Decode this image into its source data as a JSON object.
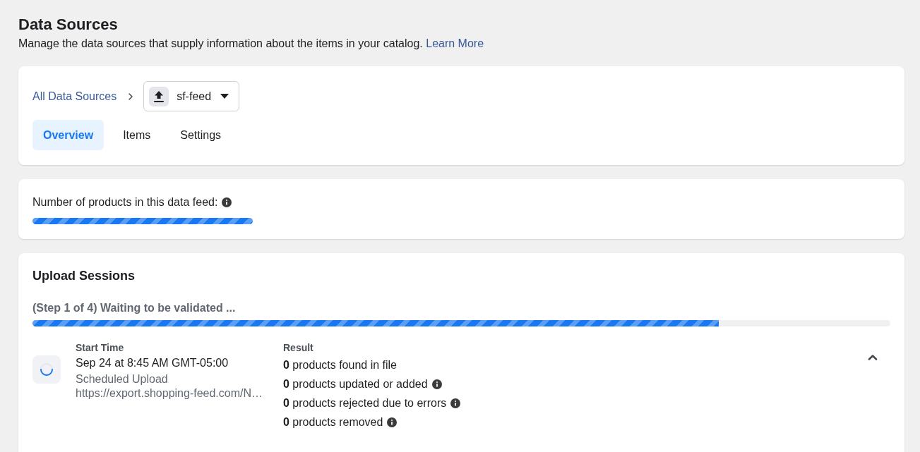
{
  "header": {
    "title": "Data Sources",
    "description": "Manage the data sources that supply information about the items in your catalog.",
    "link": "Learn More"
  },
  "source_card": {
    "breadcrumb": {
      "link": "All Data Sources"
    },
    "source_selector": {
      "value": "sf-feed"
    },
    "tabs": [
      {
        "label": "Overview",
        "selected": true
      },
      {
        "label": "Items",
        "selected": false
      },
      {
        "label": "Settings",
        "selected": false
      }
    ]
  },
  "product_count": {
    "label": "Number of products in this data feed:"
  },
  "upload_sessions": {
    "title": "Upload Sessions",
    "status": "(Step 1 of 4) Waiting to be validated ...",
    "level": 0.8,
    "sessions": [
      {
        "expanded": true,
        "start_time_label": "Start Time",
        "start_time": "Sep 24 at 8:45 AM GMT-05:00",
        "upload_type": "Scheduled Upload",
        "url": "https://export.shopping-feed.com/N…",
        "result_label": "Result",
        "results": [
          {
            "text": "**0** products found in file",
            "info": false
          },
          {
            "text": "**0** products updated or added",
            "info": true
          },
          {
            "text": "**0** products rejected due to errors",
            "info": true
          },
          {
            "text": "**0** products removed",
            "info": true
          }
        ]
      }
    ]
  }
}
